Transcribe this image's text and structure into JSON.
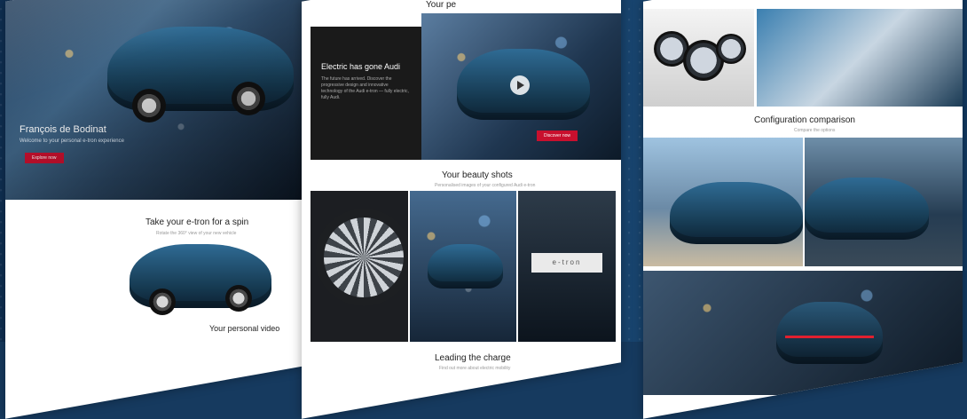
{
  "panel1": {
    "logo_text": "⊂⊃⊂⊃",
    "hero_title": "François de Bodinat",
    "hero_subtitle": "Welcome to your personal e-tron experience",
    "hero_button": "Explore now",
    "section_title": "Take your e-tron for a spin",
    "section_subtitle": "Rotate the 360° view of your new vehicle",
    "bottom_title": "Your personal video"
  },
  "panel2": {
    "top_title": "Your pe",
    "dark_card_title": "Electric has gone Audi",
    "dark_card_text": "The future has arrived. Discover the progressive design and innovative technology of the Audi e-tron — fully electric, fully Audi.",
    "dark_card_button": "Discover now",
    "beauty_title": "Your beauty shots",
    "beauty_subtitle": "Personalised images of your configured Audi e-tron",
    "charge_title": "Leading the charge",
    "charge_subtitle": "Find out more about electric mobility"
  },
  "panel3": {
    "comparison_title": "Configuration comparison",
    "comparison_subtitle": "Compare the options"
  },
  "colors": {
    "accent": "#c8102e",
    "car": "#2f6b94",
    "background": "#163a5f"
  }
}
